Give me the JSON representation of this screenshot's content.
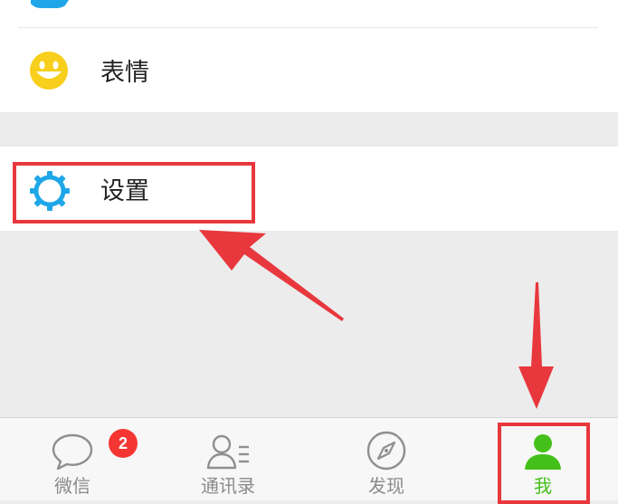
{
  "menu": {
    "emoji_label": "表情",
    "settings_label": "设置"
  },
  "tabbar": {
    "items": [
      {
        "label": "微信",
        "icon": "chat-bubble-icon",
        "badge": "2"
      },
      {
        "label": "通讯录",
        "icon": "contacts-icon"
      },
      {
        "label": "发现",
        "icon": "compass-icon"
      },
      {
        "label": "我",
        "icon": "person-icon"
      }
    ],
    "active_index": 3
  },
  "colors": {
    "accent_green": "#45c01a",
    "settings_blue": "#1fa6e8",
    "emoji_yellow": "#f7cf1c",
    "annotation_red": "#e8383d",
    "badge_red": "#f43531"
  }
}
